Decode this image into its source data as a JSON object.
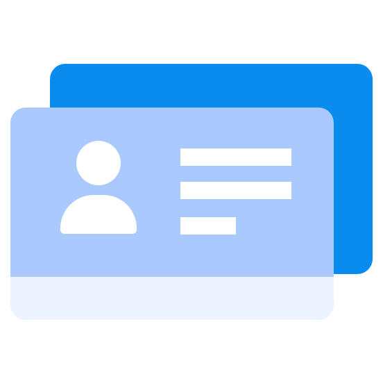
{
  "icon": {
    "name": "contact-card-icon",
    "colors": {
      "back_card": "#0a8cef",
      "front_card": "#aac9fd",
      "front_strip": "#edf4ff",
      "glyph": "#ffffff"
    }
  }
}
